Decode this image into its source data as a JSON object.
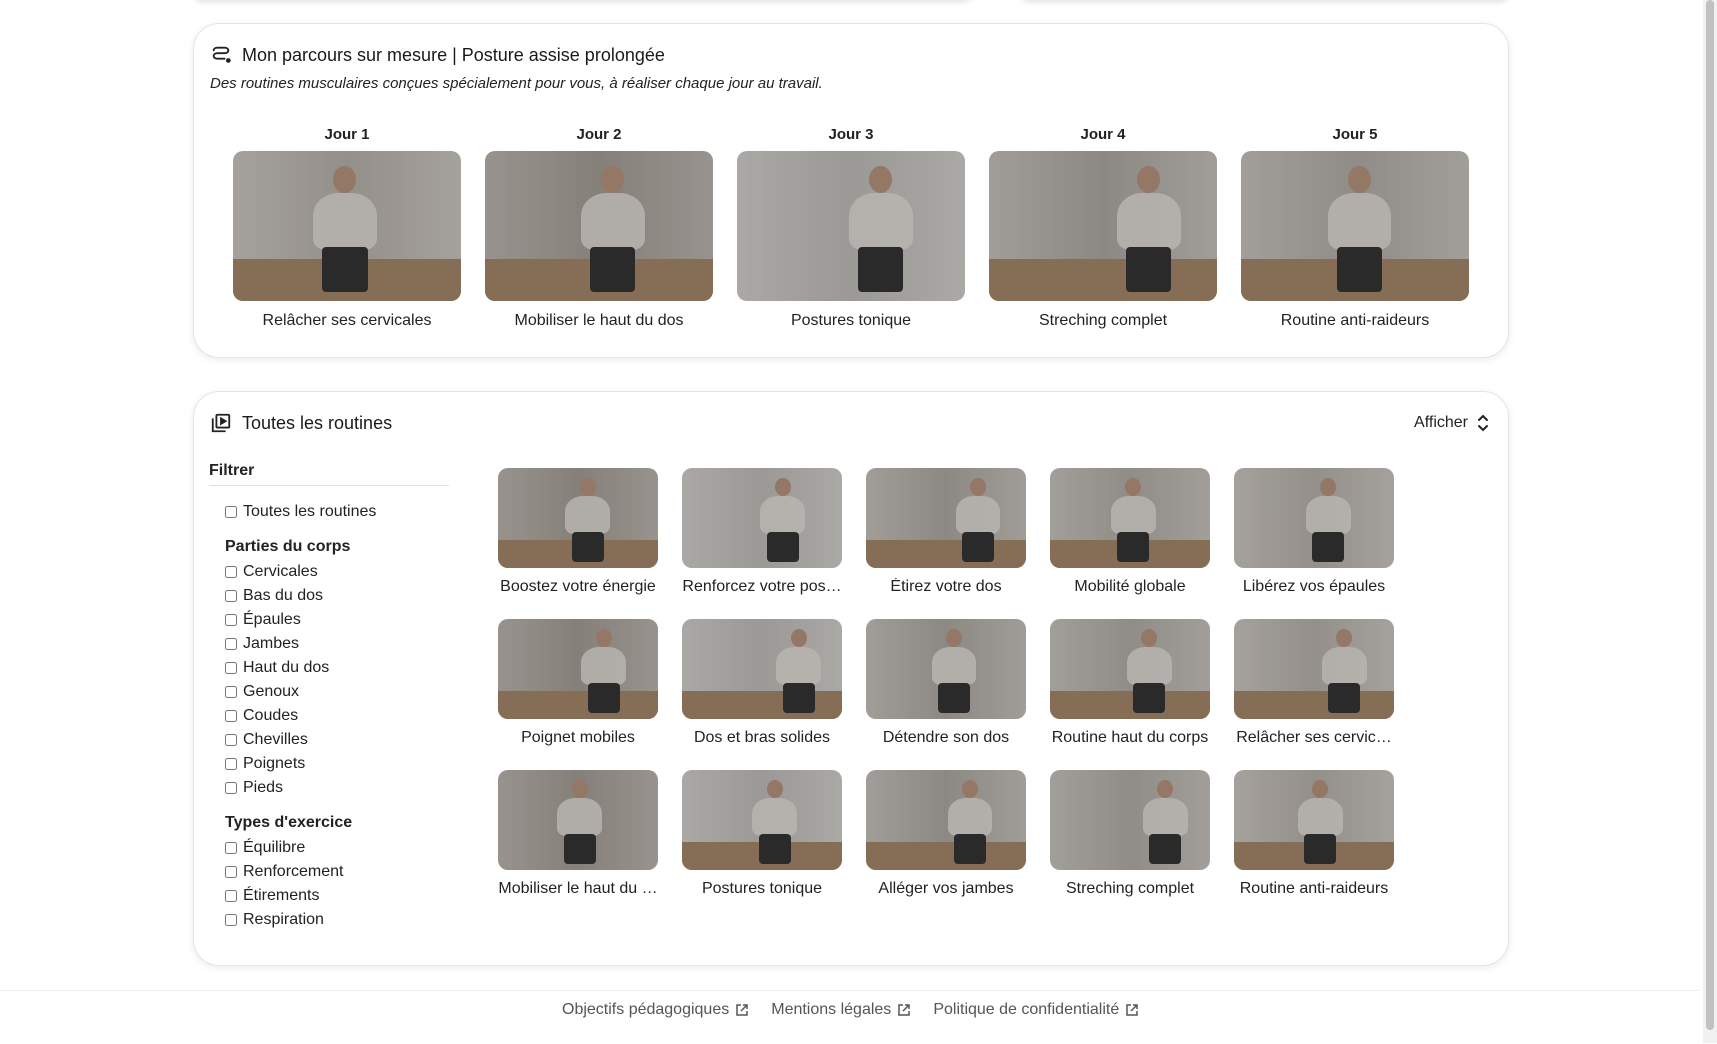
{
  "parcours": {
    "title": "Mon parcours sur mesure | Posture assise prolongée",
    "subtitle": "Des routines musculaires conçues spécialement pour vous, à réaliser chaque jour au travail.",
    "days": [
      {
        "label": "Jour 1",
        "caption": "Relâcher ses cervicales"
      },
      {
        "label": "Jour 2",
        "caption": "Mobiliser le haut du dos"
      },
      {
        "label": "Jour 3",
        "caption": "Postures tonique"
      },
      {
        "label": "Jour 4",
        "caption": "Streching complet"
      },
      {
        "label": "Jour 5",
        "caption": "Routine anti-raideurs"
      }
    ]
  },
  "routines": {
    "title": "Toutes les routines",
    "display_label": "Afficher",
    "filter": {
      "title": "Filtrer",
      "all_label": "Toutes les routines",
      "body_parts_title": "Parties du corps",
      "body_parts": [
        "Cervicales",
        "Bas du dos",
        "Épaules",
        "Jambes",
        "Haut du dos",
        "Genoux",
        "Coudes",
        "Chevilles",
        "Poignets",
        "Pieds"
      ],
      "types_title": "Types d'exercice",
      "types": [
        "Équilibre",
        "Renforcement",
        "Étirements",
        "Respiration"
      ]
    },
    "items": [
      "Boostez votre énergie",
      "Renforcez votre pos…",
      "Étirez votre dos",
      "Mobilité globale",
      "Libérez vos épaules",
      "Poignet mobiles",
      "Dos et bras solides",
      "Détendre son dos",
      "Routine haut du corps",
      "Relâcher ses cervic…",
      "Mobiliser le haut du …",
      "Postures tonique",
      "Alléger vos jambes",
      "Streching complet",
      "Routine anti-raideurs"
    ]
  },
  "footer": {
    "links": [
      "Objectifs pédagogiques",
      "Mentions légales",
      "Politique de confidentialité"
    ]
  }
}
